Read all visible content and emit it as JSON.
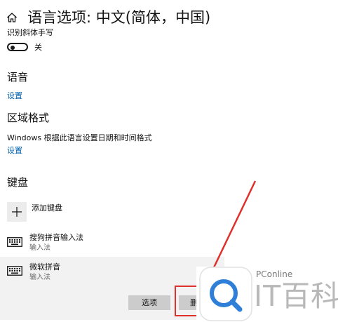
{
  "header": {
    "title": "语言选项: 中文(简体，中国)",
    "home_icon": "home-icon"
  },
  "handwriting": {
    "label": "识别斜体手写",
    "toggle_state": "关",
    "toggle_on": false
  },
  "speech": {
    "heading": "语音",
    "settings_link": "设置"
  },
  "region": {
    "heading": "区域格式",
    "description": "Windows 根据此语言设置日期和时间格式",
    "settings_link": "设置"
  },
  "keyboard": {
    "heading": "键盘",
    "add_label": "添加键盘",
    "items": [
      {
        "name": "搜狗拼音输入法",
        "type": "输入法",
        "icon": "keyboard-icon"
      },
      {
        "name": "微软拼音",
        "type": "输入法",
        "icon": "keyboard-icon"
      }
    ],
    "options_button": "选项",
    "remove_button": "删"
  },
  "watermark": {
    "small": "PConline",
    "big": "IT百科"
  },
  "colors": {
    "link": "#0063b1",
    "highlight": "#e0302b",
    "button": "#cccccc",
    "selected_row": "#f2f2f2"
  }
}
